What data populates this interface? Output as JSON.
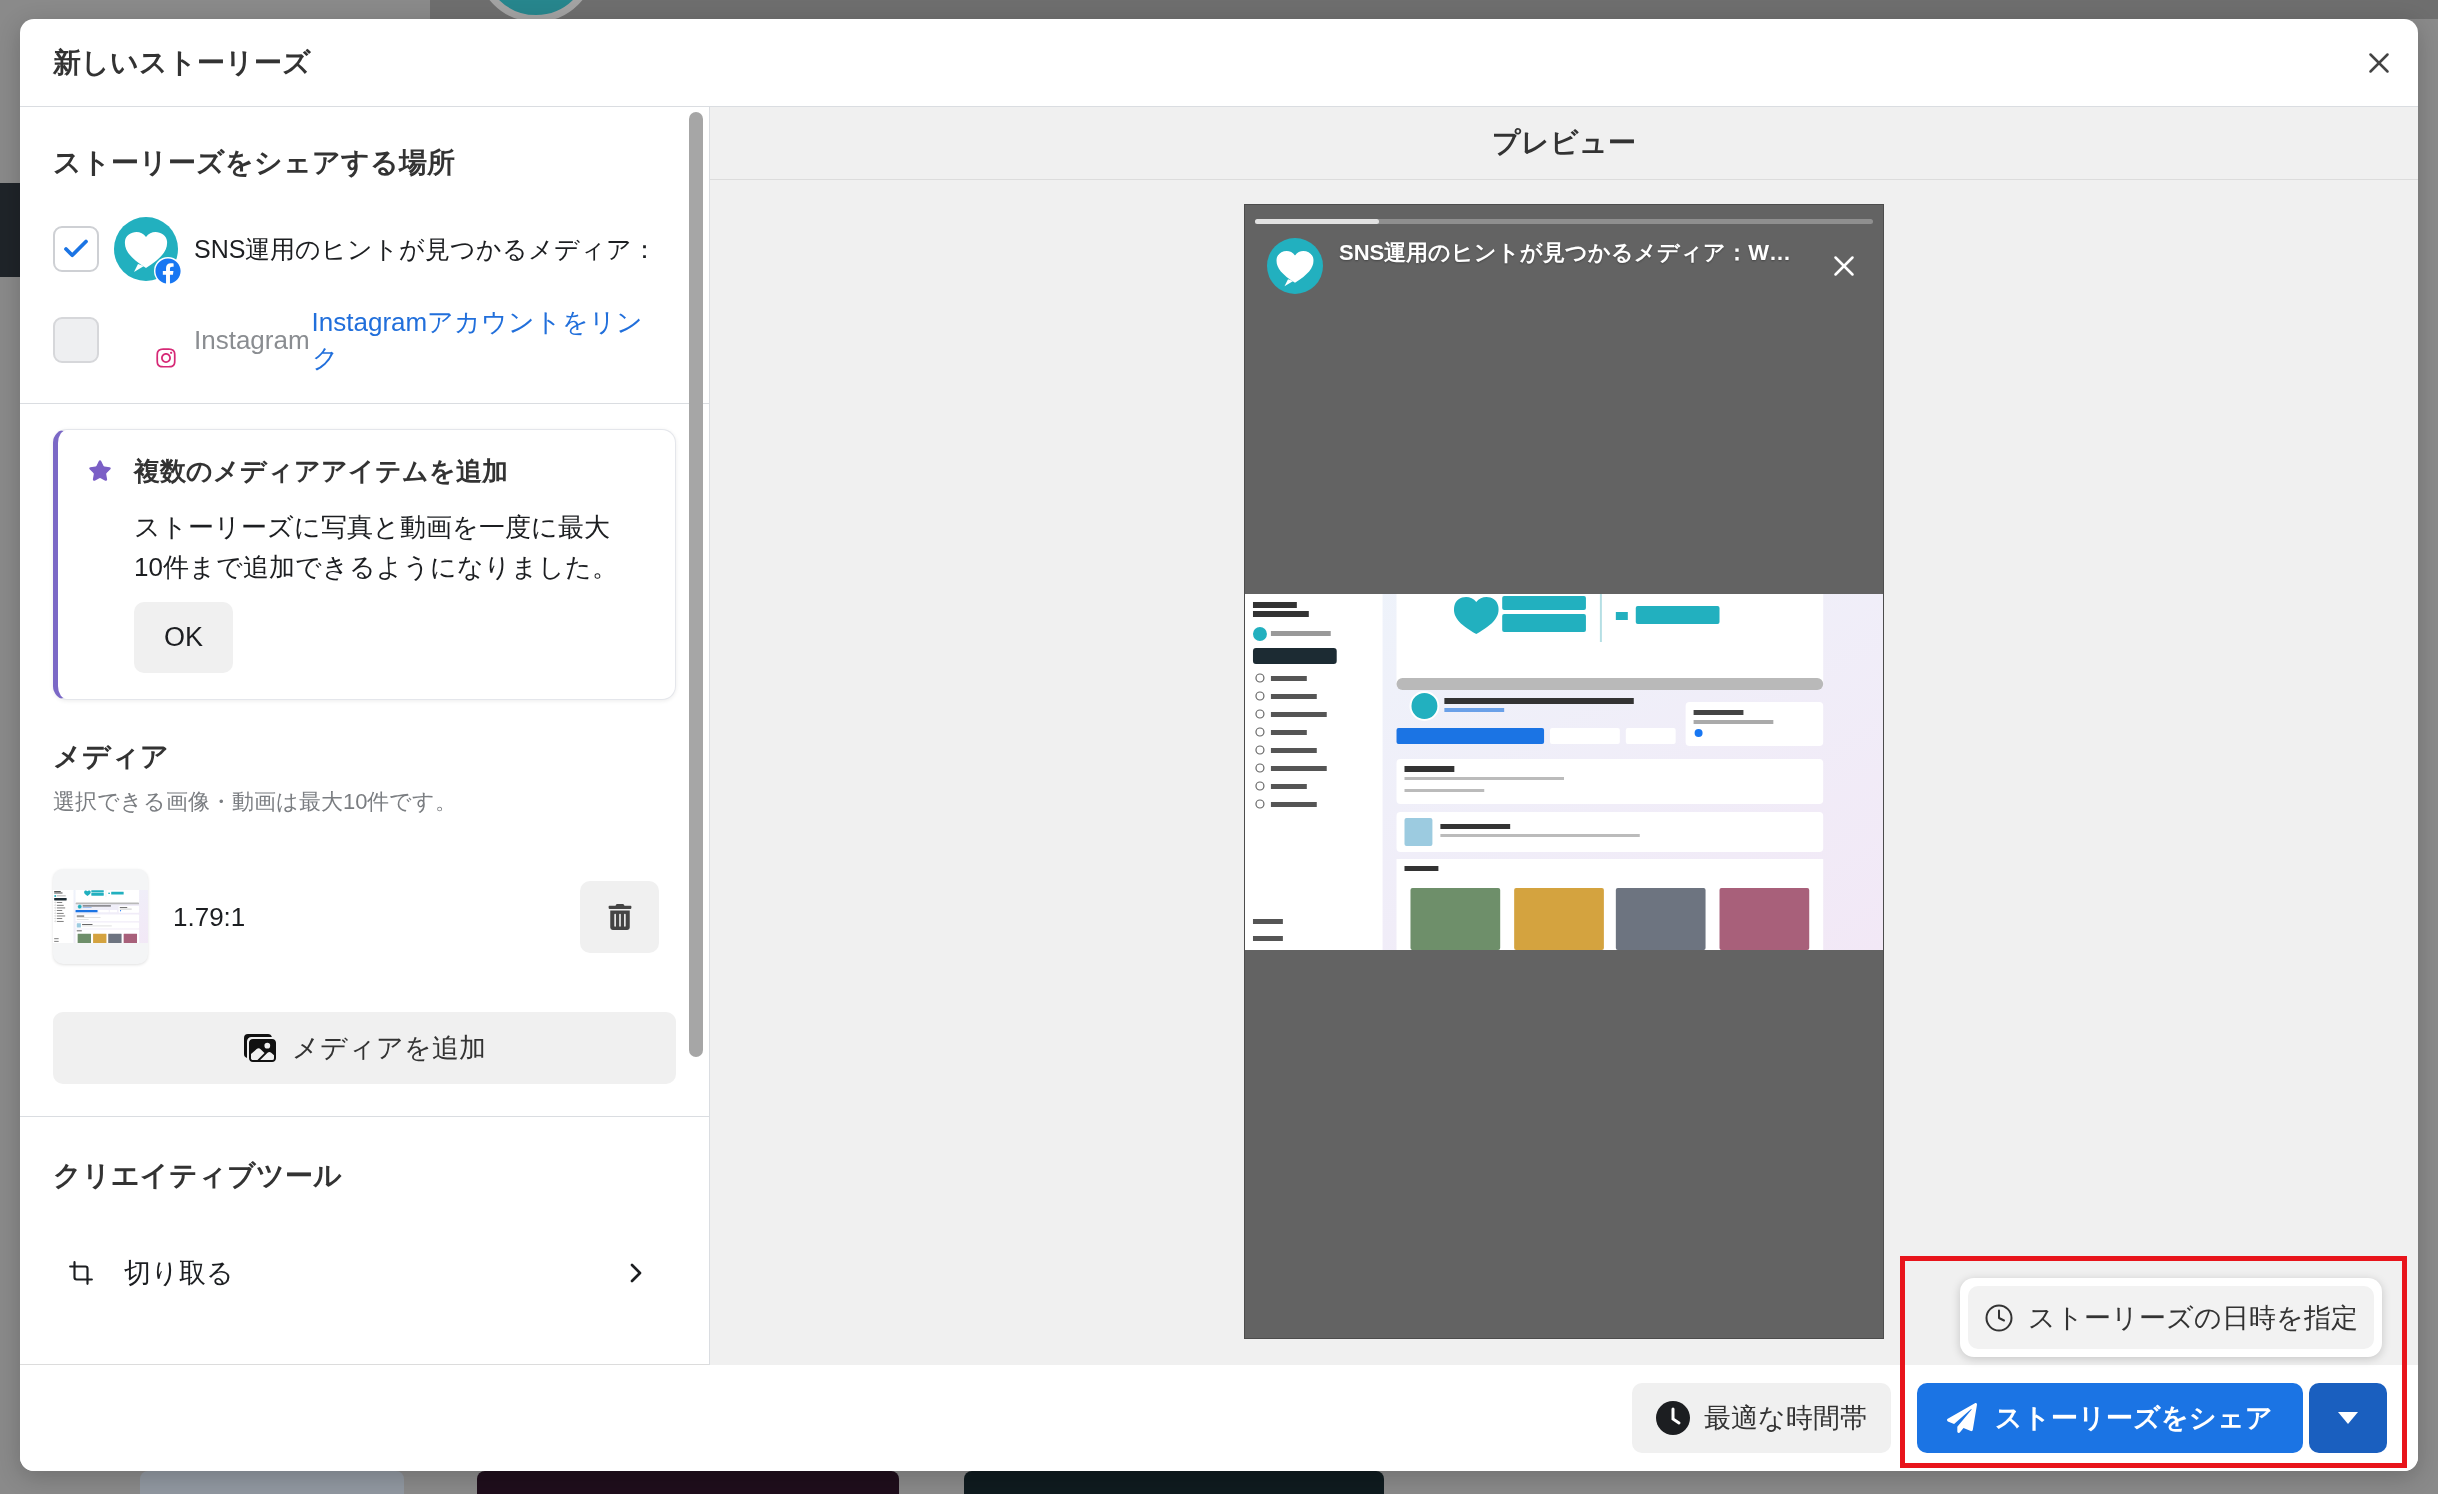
{
  "dialog": {
    "title": "新しいストーリーズ"
  },
  "destinations": {
    "heading": "ストーリーズをシェアする場所",
    "items": [
      {
        "kind": "facebook",
        "label": "SNS運用のヒントが見つかるメディア：",
        "checked": true,
        "disabled": false
      },
      {
        "kind": "instagram",
        "label": "Instagram",
        "checked": false,
        "disabled": true,
        "link": "Instagramアカウントをリンク"
      }
    ]
  },
  "notice": {
    "title": "複数のメディアアイテムを追加",
    "body": "ストーリーズに写真と動画を一度に最大10件まで追加できるようになりました。",
    "button": "OK"
  },
  "media": {
    "heading": "メディア",
    "hint": "選択できる画像・動画は最大10件です。",
    "items": [
      {
        "ratio": "1.79:1"
      }
    ],
    "add_button": "メディアを追加"
  },
  "creative_tools": {
    "heading": "クリエイティブツール",
    "items": [
      {
        "kind": "crop",
        "label": "切り取る"
      }
    ]
  },
  "preview": {
    "heading": "プレビュー",
    "story": {
      "account": "SNS運用のヒントが見つかるメディア：W…",
      "progress": {
        "level": 0.2
      }
    }
  },
  "footer": {
    "schedule_menu": [
      {
        "label": "ストーリーズの日時を指定"
      }
    ],
    "best_time_button": "最適な時間帯",
    "share_button": "ストーリーズをシェア"
  }
}
